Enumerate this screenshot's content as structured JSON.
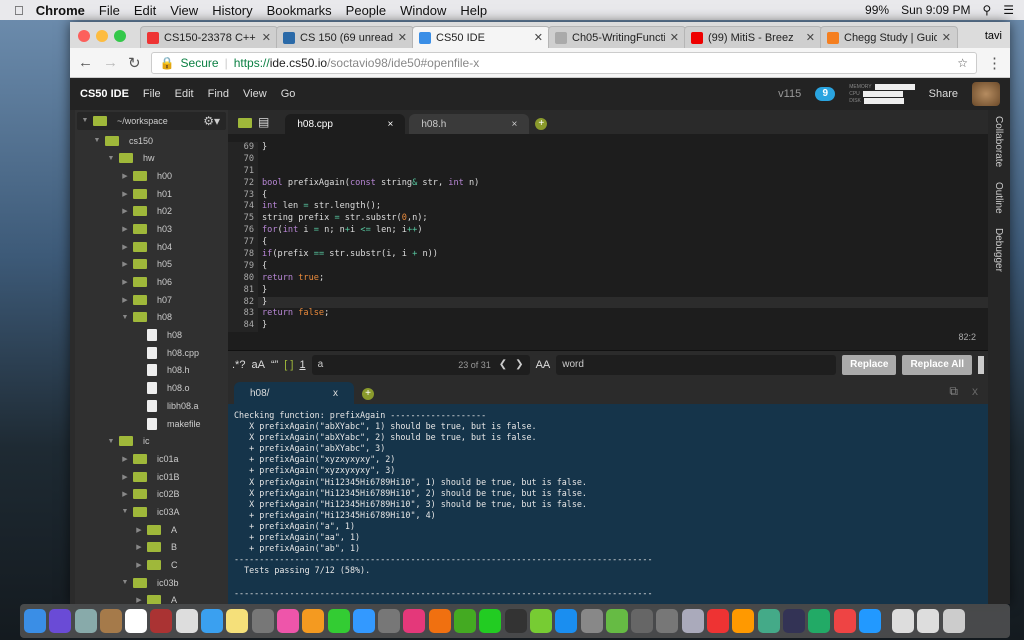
{
  "menubar": {
    "app": "Chrome",
    "items": [
      "File",
      "Edit",
      "View",
      "History",
      "Bookmarks",
      "People",
      "Window",
      "Help"
    ],
    "battery": "99%",
    "clock": "Sun 9:09 PM"
  },
  "browser": {
    "tabs": [
      {
        "title": "CS150-23378 C++",
        "color": "#e33"
      },
      {
        "title": "CS 150 (69 unread)",
        "color": "#2b6aa8"
      },
      {
        "title": "CS50 IDE",
        "color": "#3a8ee6",
        "active": true
      },
      {
        "title": "Ch05-WritingFunctio",
        "color": "#aaa"
      },
      {
        "title": "(99) MitiS - Breez",
        "color": "#e00"
      },
      {
        "title": "Chegg Study | Guide",
        "color": "#f57f20"
      }
    ],
    "profile": "tavi",
    "secure_label": "Secure",
    "url_scheme": "https://",
    "url_host": "ide.cs50.io",
    "url_path": "/soctavio98/ide50#openfile-x"
  },
  "ide": {
    "brand": "CS50 IDE",
    "menu": [
      "File",
      "Edit",
      "Find",
      "View",
      "Go"
    ],
    "version": "v115",
    "cloud_badge": "9",
    "meters": [
      "MEMORY",
      "CPU",
      "DISK"
    ],
    "share": "Share"
  },
  "sidebar": {
    "workspace": "~/workspace",
    "tree": [
      {
        "label": "cs150",
        "depth": 1,
        "type": "folder",
        "open": true
      },
      {
        "label": "hw",
        "depth": 2,
        "type": "folder",
        "open": true
      },
      {
        "label": "h00",
        "depth": 3,
        "type": "folder"
      },
      {
        "label": "h01",
        "depth": 3,
        "type": "folder"
      },
      {
        "label": "h02",
        "depth": 3,
        "type": "folder"
      },
      {
        "label": "h03",
        "depth": 3,
        "type": "folder"
      },
      {
        "label": "h04",
        "depth": 3,
        "type": "folder"
      },
      {
        "label": "h05",
        "depth": 3,
        "type": "folder"
      },
      {
        "label": "h06",
        "depth": 3,
        "type": "folder"
      },
      {
        "label": "h07",
        "depth": 3,
        "type": "folder"
      },
      {
        "label": "h08",
        "depth": 3,
        "type": "folder",
        "open": true
      },
      {
        "label": "h08",
        "depth": 4,
        "type": "file"
      },
      {
        "label": "h08.cpp",
        "depth": 4,
        "type": "file"
      },
      {
        "label": "h08.h",
        "depth": 4,
        "type": "file"
      },
      {
        "label": "h08.o",
        "depth": 4,
        "type": "file"
      },
      {
        "label": "libh08.a",
        "depth": 4,
        "type": "file"
      },
      {
        "label": "makefile",
        "depth": 4,
        "type": "file"
      },
      {
        "label": "ic",
        "depth": 2,
        "type": "folder",
        "open": true
      },
      {
        "label": "ic01a",
        "depth": 3,
        "type": "folder"
      },
      {
        "label": "ic01B",
        "depth": 3,
        "type": "folder"
      },
      {
        "label": "ic02B",
        "depth": 3,
        "type": "folder"
      },
      {
        "label": "ic03A",
        "depth": 3,
        "type": "folder",
        "open": true
      },
      {
        "label": "A",
        "depth": 4,
        "type": "folder"
      },
      {
        "label": "B",
        "depth": 4,
        "type": "folder"
      },
      {
        "label": "C",
        "depth": 4,
        "type": "folder"
      },
      {
        "label": "ic03b",
        "depth": 3,
        "type": "folder",
        "open": true
      },
      {
        "label": "A",
        "depth": 4,
        "type": "folder"
      }
    ]
  },
  "editor": {
    "tabs": [
      {
        "label": "h08.cpp",
        "active": true
      },
      {
        "label": "h08.h"
      }
    ],
    "cursor": "82:2",
    "lines": [
      {
        "n": "69",
        "t": [
          [
            "}",
            ""
          ]
        ]
      },
      {
        "n": "70",
        "t": []
      },
      {
        "n": "71",
        "t": []
      },
      {
        "n": "72",
        "t": [
          [
            "bool",
            "kw"
          ],
          [
            " prefixAgain(",
            ""
          ],
          [
            "const",
            "kw"
          ],
          [
            " string",
            ""
          ],
          [
            "&",
            "op"
          ],
          [
            " str, ",
            ""
          ],
          [
            "int",
            "kw"
          ],
          [
            " n)",
            ""
          ]
        ]
      },
      {
        "n": "73",
        "t": [
          [
            "{",
            ""
          ]
        ]
      },
      {
        "n": "74",
        "t": [
          [
            "int",
            "kw"
          ],
          [
            " len ",
            ""
          ],
          [
            "=",
            "op"
          ],
          [
            " str.length();",
            ""
          ]
        ]
      },
      {
        "n": "75",
        "t": [
          [
            "string prefix ",
            ""
          ],
          [
            "=",
            "op"
          ],
          [
            " str.substr(",
            ""
          ],
          [
            "0",
            "num"
          ],
          [
            ",n);",
            ""
          ]
        ]
      },
      {
        "n": "76",
        "t": [
          [
            "for",
            "kw"
          ],
          [
            "(",
            ""
          ],
          [
            "int",
            "kw"
          ],
          [
            " i ",
            ""
          ],
          [
            "=",
            "op"
          ],
          [
            " n; n",
            ""
          ],
          [
            "+",
            "op"
          ],
          [
            "i ",
            ""
          ],
          [
            "<=",
            "op"
          ],
          [
            " len; i",
            ""
          ],
          [
            "++",
            "op"
          ],
          [
            ")",
            ""
          ]
        ]
      },
      {
        "n": "77",
        "t": [
          [
            "{",
            ""
          ]
        ]
      },
      {
        "n": "78",
        "t": [
          [
            "if",
            "kw"
          ],
          [
            "(prefix ",
            ""
          ],
          [
            "==",
            "op"
          ],
          [
            " str.substr(i, i ",
            ""
          ],
          [
            "+",
            "op"
          ],
          [
            " n))",
            ""
          ]
        ]
      },
      {
        "n": "79",
        "t": [
          [
            "{",
            ""
          ]
        ]
      },
      {
        "n": "80",
        "t": [
          [
            "return",
            "kw"
          ],
          [
            " ",
            ""
          ],
          [
            "true",
            "bool"
          ],
          [
            ";",
            ""
          ]
        ]
      },
      {
        "n": "81",
        "t": [
          [
            "}",
            ""
          ]
        ]
      },
      {
        "n": "82",
        "t": [
          [
            "}",
            ""
          ]
        ],
        "hl": true
      },
      {
        "n": "83",
        "t": [
          [
            "return",
            "kw"
          ],
          [
            " ",
            ""
          ],
          [
            "false",
            "bool"
          ],
          [
            ";",
            ""
          ]
        ]
      },
      {
        "n": "84",
        "t": [
          [
            "}",
            ""
          ]
        ]
      }
    ]
  },
  "find": {
    "regex": ".*?",
    "case": "aA",
    "word": "“”",
    "selection": "[ ]",
    "wrap": "1",
    "search_value": "a",
    "match_count": "23 of 31",
    "preserve_case": "AA",
    "replace_value": "word",
    "replace": "Replace",
    "replace_all": "Replace All"
  },
  "terminal": {
    "tab": "h08/",
    "output": "Checking function: prefixAgain -------------------\n   X prefixAgain(\"abXYabc\", 1) should be true, but is false.\n   X prefixAgain(\"abXYabc\", 2) should be true, but is false.\n   + prefixAgain(\"abXYabc\", 3)\n   + prefixAgain(\"xyzxyxyxy\", 2)\n   + prefixAgain(\"xyzxyxyxy\", 3)\n   X prefixAgain(\"Hi12345Hi6789Hi10\", 1) should be true, but is false.\n   X prefixAgain(\"Hi12345Hi6789Hi10\", 2) should be true, but is false.\n   X prefixAgain(\"Hi12345Hi6789Hi10\", 3) should be true, but is false.\n   + prefixAgain(\"Hi12345Hi6789Hi10\", 4)\n   + prefixAgain(\"a\", 1)\n   + prefixAgain(\"aa\", 1)\n   + prefixAgain(\"ab\", 1)\n-----------------------------------------------------------------------------------\n  Tests passing 7/12 (58%).\n\n-----------------------------------------------------------------------------------"
  },
  "right_panel": [
    "Collaborate",
    "Outline",
    "Debugger"
  ],
  "dock": {
    "icons": [
      [
        "finder",
        "#3a8ee6"
      ],
      [
        "siri",
        "#6a4bd6"
      ],
      [
        "preview",
        "#8aa"
      ],
      [
        "contacts",
        "#a57a4a"
      ],
      [
        "calendar",
        "#fff"
      ],
      [
        "dictionary",
        "#a33"
      ],
      [
        "chrome-canary",
        "#ddd"
      ],
      [
        "messages",
        "#3aa0f0"
      ],
      [
        "notes",
        "#f5e07a"
      ],
      [
        "unknown",
        "#777"
      ],
      [
        "photos",
        "#e5a"
      ],
      [
        "pages",
        "#f49a20"
      ],
      [
        "numbers",
        "#3c3"
      ],
      [
        "keynote",
        "#39f"
      ],
      [
        "unknown",
        "#777"
      ],
      [
        "itunes",
        "#e4387a"
      ],
      [
        "ibooks",
        "#f07010"
      ],
      [
        "fl-studio",
        "#4a2"
      ],
      [
        "facetime",
        "#2c2"
      ],
      [
        "dashboard",
        "#333"
      ],
      [
        "android-emulator",
        "#7c3"
      ],
      [
        "app-store",
        "#1a8ef0"
      ],
      [
        "system-preferences",
        "#888"
      ],
      [
        "android-studio",
        "#6b4"
      ],
      [
        "utility",
        "#666"
      ],
      [
        "unknown",
        "#777"
      ],
      [
        "image-capture",
        "#aab"
      ],
      [
        "powerpoint",
        "#e33"
      ],
      [
        "openoffice",
        "#f90"
      ],
      [
        "download",
        "#4a8"
      ],
      [
        "eclipse",
        "#335"
      ],
      [
        "excel",
        "#2a6"
      ],
      [
        "chrome",
        "#e44"
      ],
      [
        "safari",
        "#29f"
      ],
      [
        "window-1",
        "#ddd"
      ],
      [
        "window-2",
        "#ddd"
      ],
      [
        "trash",
        "#ccc"
      ]
    ]
  }
}
